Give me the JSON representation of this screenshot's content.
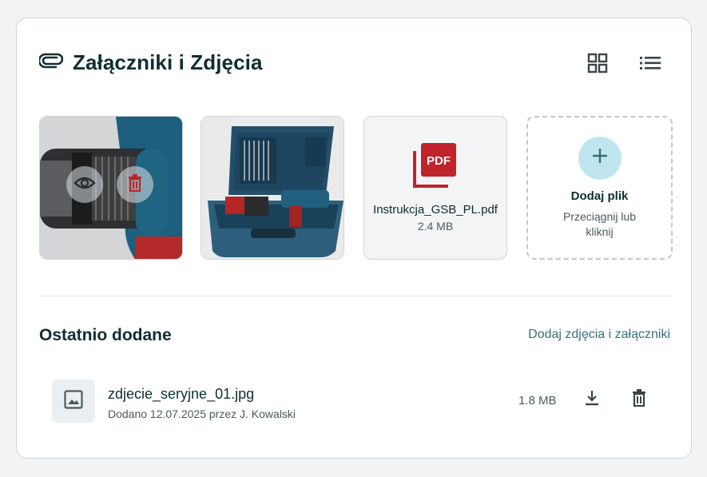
{
  "header": {
    "title": "Załączniki i Zdjęcia",
    "icon": "paperclip-icon"
  },
  "view_toggle": {
    "grid_icon": "grid-view-icon",
    "list_icon": "list-view-icon"
  },
  "tiles": [
    {
      "type": "image",
      "subject": "drill close-up",
      "actions": [
        "eye-icon",
        "trash-icon"
      ]
    },
    {
      "type": "image",
      "subject": "drill in blue case"
    },
    {
      "type": "pdf",
      "badge": "PDF",
      "name": "Instrukcja_GSB_PL.pdf",
      "size": "2.4 MB"
    },
    {
      "type": "upload",
      "title": "Dodaj plik",
      "subtitle": "Przeciągnij lub kliknij"
    }
  ],
  "recent": {
    "title": "Ostatnio dodane",
    "link": "Dodaj zdjęcia i załączniki",
    "items": [
      {
        "name": "zdjecie_seryjne_01.jpg",
        "meta": "Dodano 12.07.2025 przez J. Kowalski",
        "size": "1.8 MB"
      }
    ]
  },
  "colors": {
    "primary": "#0f2e33",
    "accent": "#356f7a",
    "pdf_red": "#c0232b",
    "upload_circle": "#bfe6ee"
  }
}
